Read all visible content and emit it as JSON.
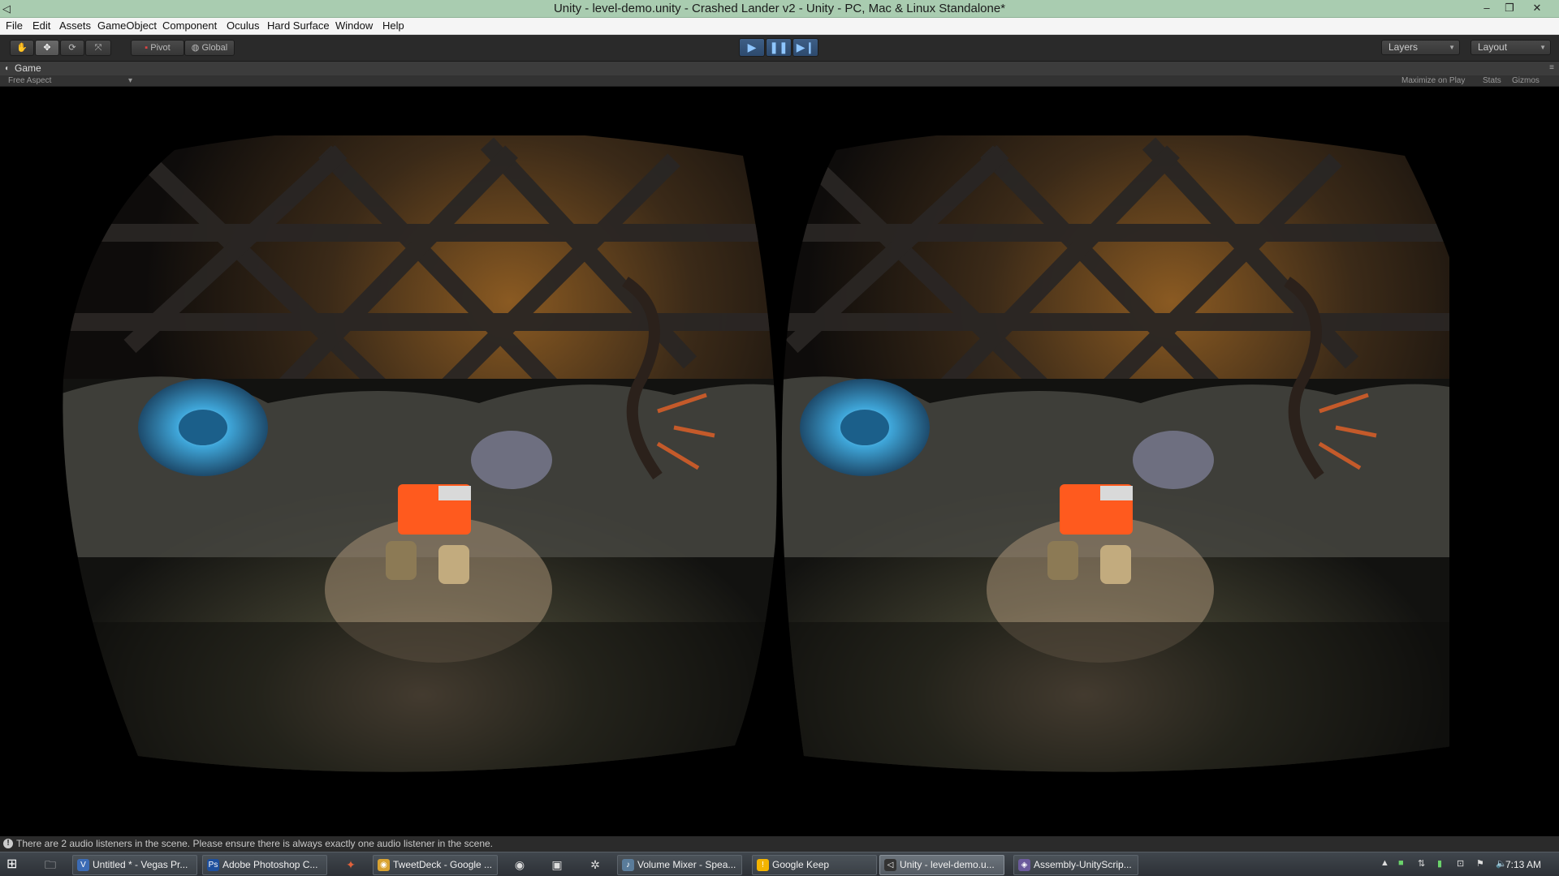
{
  "window": {
    "title": "Unity - level-demo.unity - Crashed Lander v2 - Unity - PC, Mac & Linux Standalone*",
    "minimize": "–",
    "restore": "❐",
    "close": "✕"
  },
  "menu": [
    "File",
    "Edit",
    "Assets",
    "GameObject",
    "Component",
    "Oculus",
    "Hard Surface",
    "Window",
    "Help"
  ],
  "toolbar": {
    "pivot_label": "Pivot",
    "global_label": "Global",
    "layers_label": "Layers",
    "layout_label": "Layout"
  },
  "game_panel": {
    "tab_label": "Game",
    "aspect_label": "Free Aspect",
    "maximize_on_play": "Maximize on Play",
    "stats": "Stats",
    "gizmos": "Gizmos"
  },
  "status": {
    "message": "There are 2 audio listeners in the scene. Please ensure there is always exactly one audio listener in the scene."
  },
  "taskbar": {
    "items": [
      {
        "label": "Untitled * - Vegas Pr...",
        "color": "#3b6bb5",
        "icon": "vegas-icon"
      },
      {
        "label": "Adobe Photoshop C...",
        "color": "#1e4f9c",
        "icon": "photoshop-icon"
      },
      {
        "label": "TweetDeck - Google ...",
        "color": "#d9a332",
        "icon": "chrome-icon"
      },
      {
        "label": "Volume Mixer - Spea...",
        "color": "#5a7c9a",
        "icon": "speaker-icon"
      },
      {
        "label": "Google Keep",
        "color": "#f4b400",
        "icon": "keep-icon"
      },
      {
        "label": "Unity - level-demo.u...",
        "color": "#333333",
        "icon": "unity-icon"
      },
      {
        "label": "Assembly-UnityScrip...",
        "color": "#6b5a9c",
        "icon": "monodevelop-icon"
      }
    ],
    "clock": "7:13 AM"
  }
}
